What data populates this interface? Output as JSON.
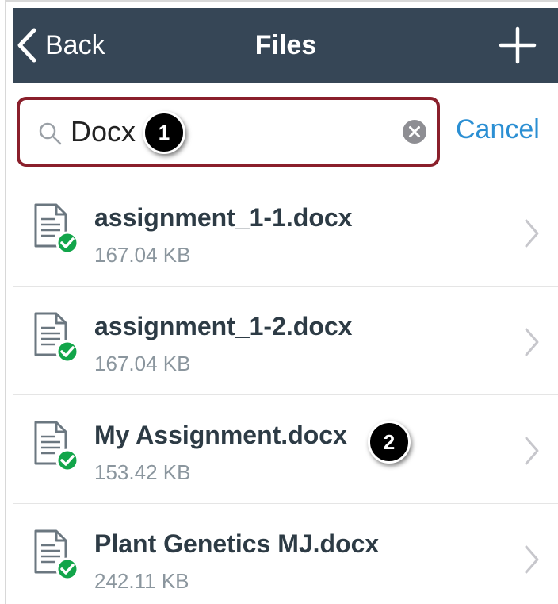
{
  "navbar": {
    "back_label": "Back",
    "title": "Files",
    "add_icon": "plus-icon",
    "bg_color": "#364656"
  },
  "search": {
    "value": "Docx",
    "cancel_label": "Cancel",
    "highlight_color": "#8a1f2b"
  },
  "callouts": [
    "1",
    "2"
  ],
  "files": [
    {
      "name": "assignment_1-1.docx",
      "size": "167.04 KB",
      "status": "synced"
    },
    {
      "name": "assignment_1-2.docx",
      "size": "167.04 KB",
      "status": "synced"
    },
    {
      "name": "My Assignment.docx",
      "size": "153.42 KB",
      "status": "synced"
    },
    {
      "name": "Plant Genetics MJ.docx",
      "size": "242.11 KB",
      "status": "synced"
    }
  ]
}
